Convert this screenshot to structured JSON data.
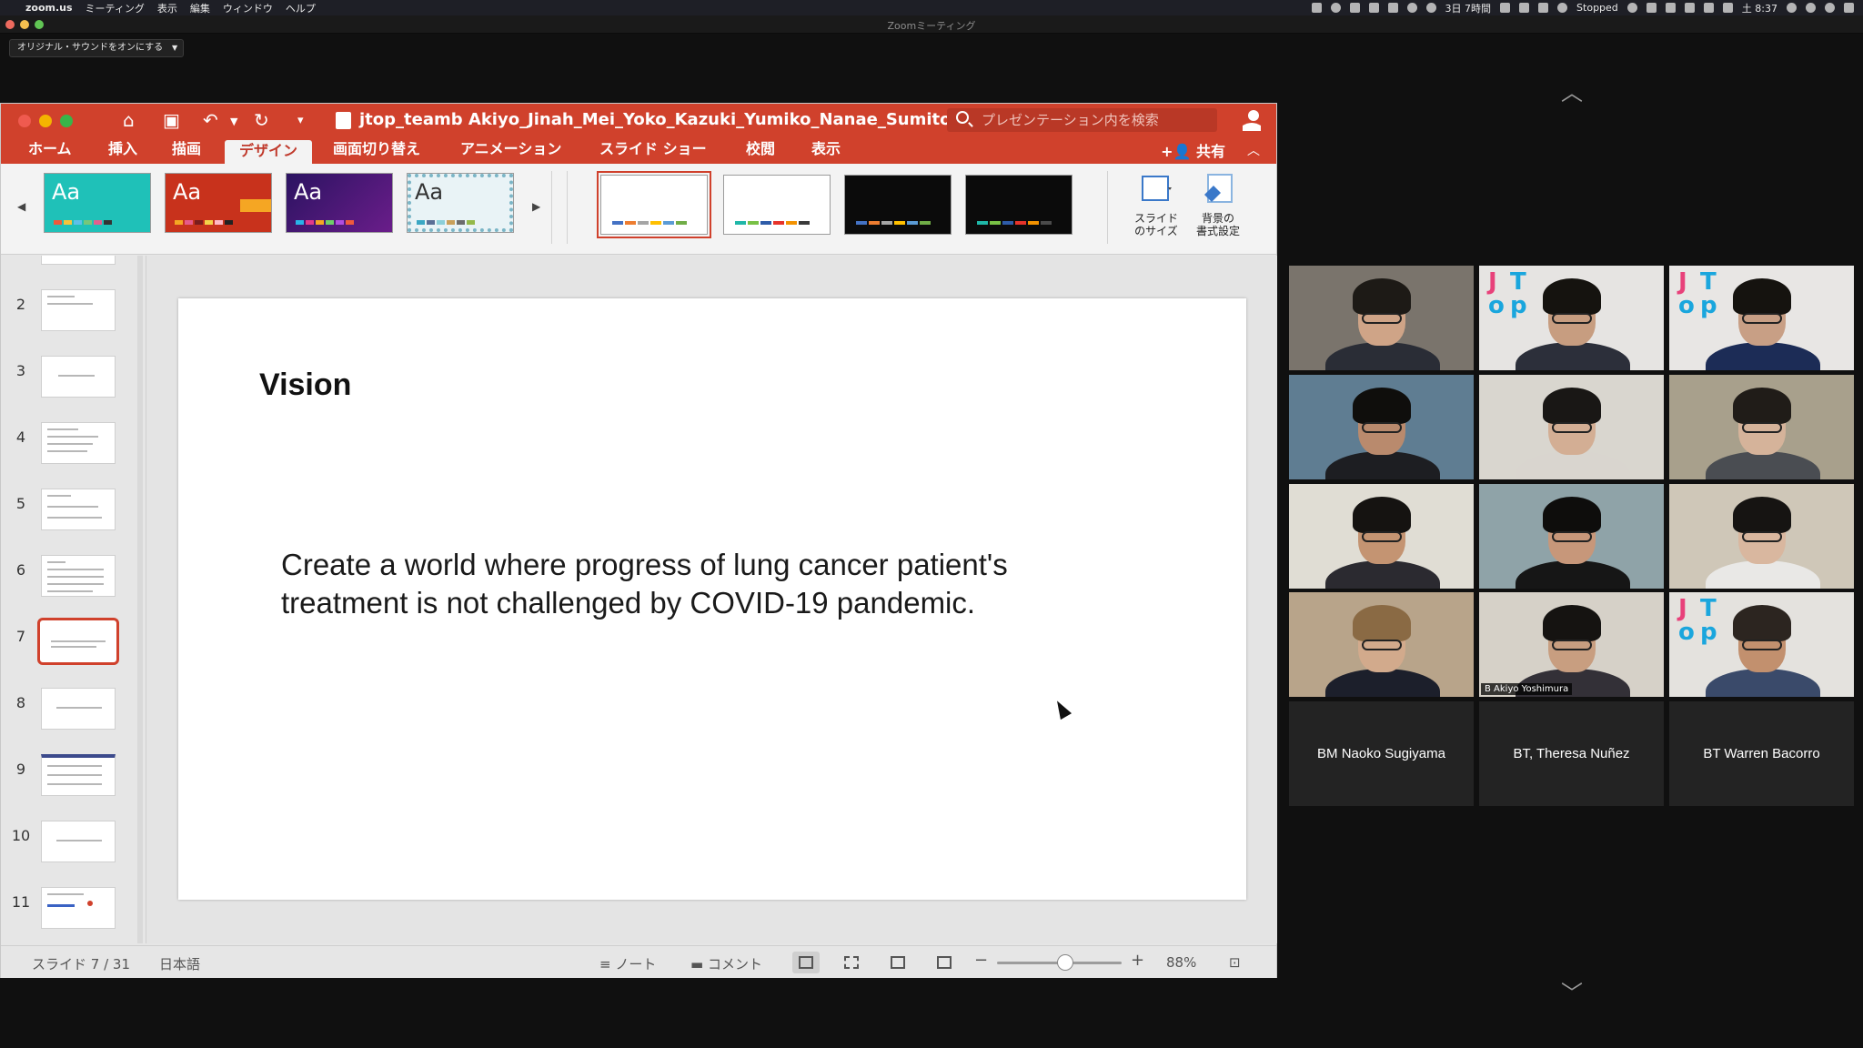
{
  "menubar": {
    "app": "zoom.us",
    "menus": [
      "ミーティング",
      "表示",
      "編集",
      "ウィンドウ",
      "ヘルプ"
    ],
    "status_items": {
      "duration": "3日 7時間",
      "stopped": "Stopped",
      "clock": "土 8:37"
    }
  },
  "zoom": {
    "window_title": "Zoomミーティング",
    "sound_button": "オリジナル・サウンドをオンにする"
  },
  "ppt": {
    "doc_title": "jtop_teamb Akiyo_Jinah_Mei_Yoko_Kazuki_Yumiko_Nanae_Sumito...",
    "search_placeholder": "プレゼンテーション内を検索",
    "tabs": [
      "ホーム",
      "挿入",
      "描画",
      "デザイン",
      "画面切り替え",
      "アニメーション",
      "スライド ショー",
      "校閲",
      "表示"
    ],
    "active_tab": "デザイン",
    "share": "共有",
    "themes": [
      {
        "label": "Aa",
        "bg": "#1fc1b8"
      },
      {
        "label": "Aa",
        "bg": "#c8321c"
      },
      {
        "label": "Aa",
        "bg": "#3c1f76"
      },
      {
        "label": "Aa",
        "bg": "#e9f3f6"
      }
    ],
    "variants": [
      {
        "bg": "#ffffff",
        "selected": true
      },
      {
        "bg": "#ffffff",
        "selected": false
      },
      {
        "bg": "#0b0b0b",
        "selected": false
      },
      {
        "bg": "#0b0b0b",
        "selected": false
      }
    ],
    "commands": {
      "slide_size_1": "スライド",
      "slide_size_2": "のサイズ",
      "bg_format_1": "背景の",
      "bg_format_2": "書式設定"
    },
    "thumbnails": [
      "2",
      "3",
      "4",
      "5",
      "6",
      "7",
      "8",
      "9",
      "10",
      "11"
    ],
    "selected_slide": "7",
    "slide": {
      "title": "Vision",
      "body": "Create a world where progress of lung cancer patient's treatment is not challenged by COVID-19 pandemic."
    },
    "status": {
      "slide_counter": "スライド 7 / 31",
      "language": "日本語",
      "notes": "ノート",
      "comments": "コメント",
      "zoom": "88%",
      "zoom_value_pct": 88
    }
  },
  "gallery": {
    "video_tiles": [
      {
        "name": "",
        "logo": false,
        "hair": "#1d1a16",
        "skin": "#cfa487",
        "shirt": "#2a2d36",
        "bg": "#7a746c"
      },
      {
        "name": "",
        "logo": true,
        "hair": "#15130f",
        "skin": "#c79d80",
        "shirt": "#2c2f3a",
        "bg": "#e6e4e2"
      },
      {
        "name": "",
        "logo": true,
        "hair": "#15130f",
        "skin": "#c89f85",
        "shirt": "#1c2c56",
        "bg": "#e8e6e4"
      },
      {
        "name": "",
        "logo": false,
        "hair": "#0f0e0c",
        "skin": "#b98a6d",
        "shirt": "#1d1e22",
        "bg": "#5f7d92"
      },
      {
        "name": "",
        "logo": false,
        "hair": "#191715",
        "skin": "#d3ae94",
        "shirt": "#d9d5cf",
        "bg": "#d9d6cf"
      },
      {
        "name": "",
        "logo": false,
        "hair": "#201c18",
        "skin": "#d5b39a",
        "shirt": "#4a4d52",
        "bg": "#a8a08c"
      },
      {
        "name": "",
        "logo": false,
        "hair": "#151311",
        "skin": "#c49472",
        "shirt": "#2b2a30",
        "bg": "#e0ddd4"
      },
      {
        "name": "",
        "logo": false,
        "hair": "#0e0d0c",
        "skin": "#c7977a",
        "shirt": "#161616",
        "bg": "#8fa3a8"
      },
      {
        "name": "",
        "logo": false,
        "hair": "#161412",
        "skin": "#d9b79f",
        "shirt": "#e9e8e6",
        "bg": "#cfc7b8"
      },
      {
        "name": "",
        "logo": false,
        "hair": "#8a6a44",
        "skin": "#d2aa8c",
        "shirt": "#1c1f2b",
        "bg": "#b8a48a"
      },
      {
        "name": "B Akiyo Yoshimura",
        "logo": false,
        "hair": "#151311",
        "skin": "#c89e80",
        "shirt": "#333037",
        "bg": "#d6d1c8",
        "active": true
      },
      {
        "name": "",
        "logo": true,
        "hair": "#2c2520",
        "skin": "#c2906e",
        "shirt": "#3a4a6a",
        "bg": "#e4e2de"
      }
    ],
    "name_tiles": [
      "BM Naoko Sugiyama",
      "BT, Theresa Nuñez",
      "BT Warren Bacorro"
    ]
  },
  "colors": {
    "ppt_accent": "#d0412c",
    "active_speaker": "#c8d42a",
    "logo_pink": "#e8417a",
    "logo_blue": "#1aa6dd"
  }
}
